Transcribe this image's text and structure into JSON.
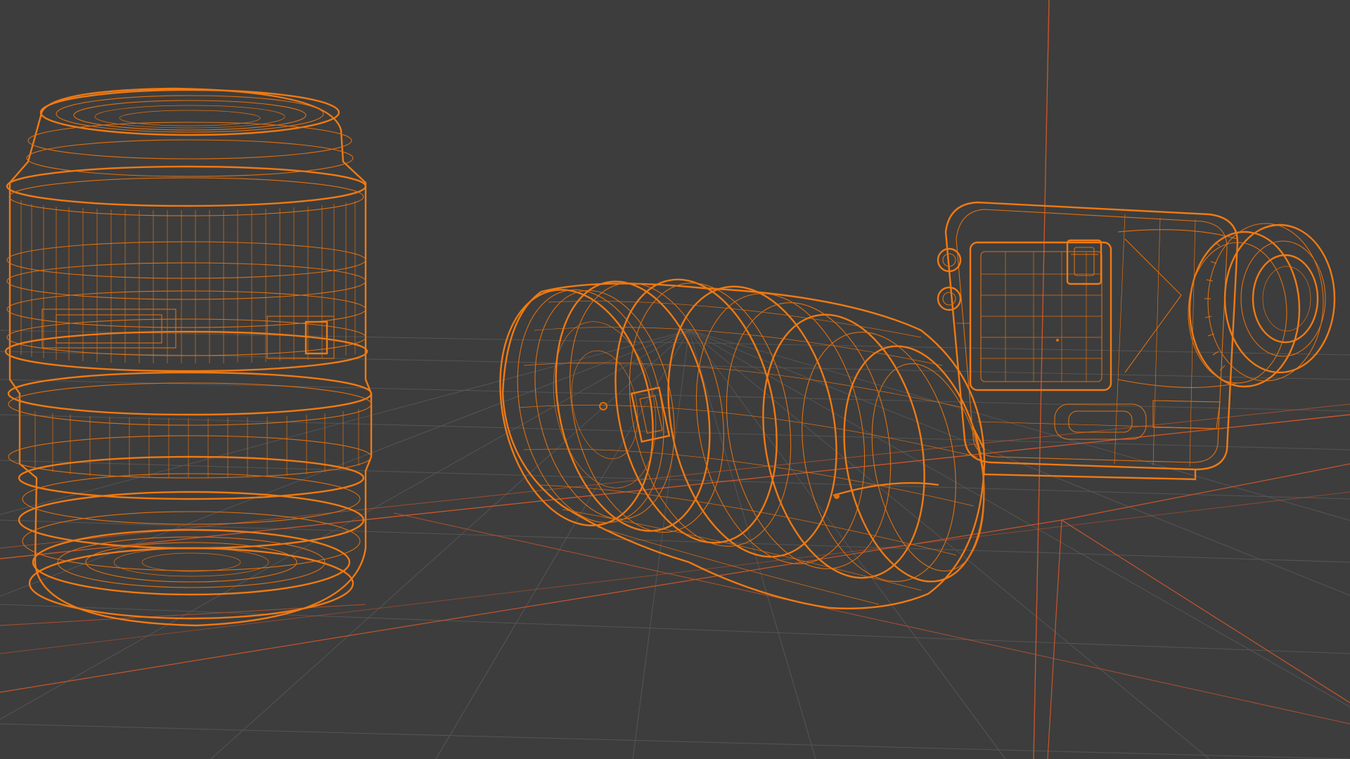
{
  "viewport": {
    "mode": "wireframe",
    "background_color": "#3d3d3d",
    "grid_color": "#555555",
    "selection_color": "#e0700f",
    "axis_color": "#c8552a",
    "objects": [
      {
        "name": "vertical-lens",
        "selected": true
      },
      {
        "name": "lying-lens",
        "selected": true
      },
      {
        "name": "camera-body",
        "selected": true
      }
    ]
  }
}
